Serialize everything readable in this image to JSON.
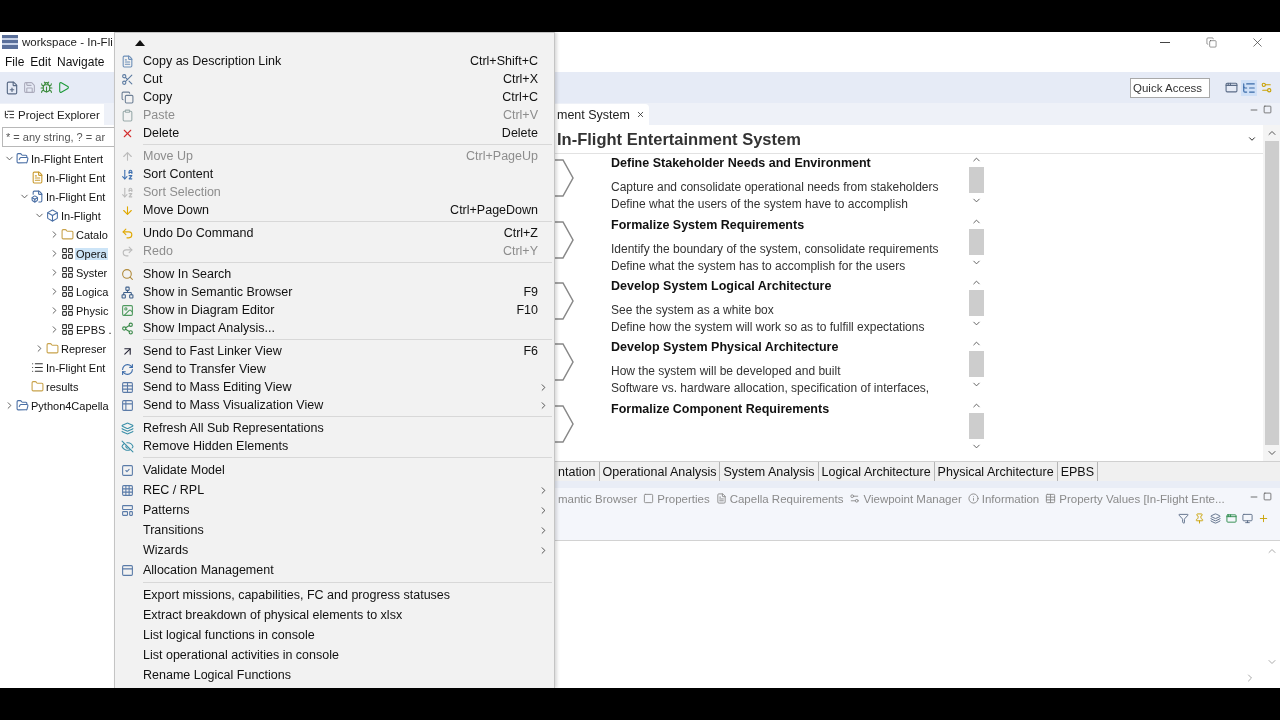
{
  "window": {
    "title": "workspace - In-Fli"
  },
  "menu_bar": [
    "File",
    "Edit",
    "Navigate"
  ],
  "quick_access": {
    "placeholder": "Quick Access"
  },
  "project_explorer": {
    "tab": "Project Explorer",
    "filter": {
      "placeholder": "* = any string, ? = ar"
    },
    "tree": [
      {
        "label": "In-Flight Entert",
        "kind": "project",
        "selected": false,
        "expanded": true,
        "children": [
          {
            "label": "In-Flight Ent",
            "kind": "session",
            "selected": false
          },
          {
            "label": "In-Flight Ent",
            "kind": "model",
            "selected": false,
            "expanded": true,
            "children": [
              {
                "label": "In-Flight",
                "kind": "root",
                "selected": false,
                "expanded": true,
                "children": [
                  {
                    "label": "Catalo",
                    "kind": "folder",
                    "selected": false,
                    "expanded": false
                  },
                  {
                    "label": "Opera",
                    "kind": "layer",
                    "selected": true,
                    "expanded": false
                  },
                  {
                    "label": "Syster",
                    "kind": "layer",
                    "selected": false,
                    "expanded": false
                  },
                  {
                    "label": "Logica",
                    "kind": "layer",
                    "selected": false,
                    "expanded": false
                  },
                  {
                    "label": "Physic",
                    "kind": "layer",
                    "selected": false,
                    "expanded": false
                  },
                  {
                    "label": "EPBS .",
                    "kind": "layer",
                    "selected": false,
                    "expanded": false
                  }
                ]
              },
              {
                "label": "Represer",
                "kind": "folder",
                "selected": false,
                "expanded": false
              }
            ]
          },
          {
            "label": "In-Flight Ent",
            "kind": "list",
            "selected": false
          },
          {
            "label": "results",
            "kind": "folder",
            "selected": false
          }
        ]
      },
      {
        "label": "Python4Capella",
        "kind": "project",
        "selected": false,
        "expanded": false
      }
    ]
  },
  "context_menu": {
    "groups": [
      [
        {
          "label": "Copy as Description Link",
          "shortcut": "Ctrl+Shift+C",
          "disabled": false,
          "submenu": false
        },
        {
          "label": "Cut",
          "shortcut": "Ctrl+X",
          "disabled": false,
          "submenu": false
        },
        {
          "label": "Copy",
          "shortcut": "Ctrl+C",
          "disabled": false,
          "submenu": false
        },
        {
          "label": "Paste",
          "shortcut": "Ctrl+V",
          "disabled": true,
          "submenu": false
        },
        {
          "label": "Delete",
          "shortcut": "Delete",
          "disabled": false,
          "submenu": false
        }
      ],
      [
        {
          "label": "Move Up",
          "shortcut": "Ctrl+PageUp",
          "disabled": true,
          "submenu": false
        },
        {
          "label": "Sort Content",
          "disabled": false,
          "submenu": false
        },
        {
          "label": "Sort Selection",
          "disabled": true,
          "submenu": false
        },
        {
          "label": "Move Down",
          "shortcut": "Ctrl+PageDown",
          "disabled": false,
          "submenu": false
        }
      ],
      [
        {
          "label": "Undo Do Command",
          "shortcut": "Ctrl+Z",
          "disabled": false,
          "submenu": false
        },
        {
          "label": "Redo",
          "shortcut": "Ctrl+Y",
          "disabled": true,
          "submenu": false
        }
      ],
      [
        {
          "label": "Show In Search",
          "disabled": false,
          "submenu": false
        },
        {
          "label": "Show in Semantic Browser",
          "shortcut": "F9",
          "disabled": false,
          "submenu": false
        },
        {
          "label": "Show in Diagram Editor",
          "shortcut": "F10",
          "disabled": false,
          "submenu": false
        },
        {
          "label": "Show Impact Analysis...",
          "disabled": false,
          "submenu": false
        }
      ],
      [
        {
          "label": "Send to Fast Linker View",
          "shortcut": "F6",
          "disabled": false,
          "submenu": false
        },
        {
          "label": "Send to Transfer View",
          "disabled": false,
          "submenu": false
        },
        {
          "label": "Send to Mass Editing View",
          "disabled": false,
          "submenu": true
        },
        {
          "label": "Send to Mass Visualization View",
          "disabled": false,
          "submenu": true
        }
      ],
      [
        {
          "label": "Refresh All Sub Representations",
          "disabled": false,
          "submenu": false
        },
        {
          "label": "Remove Hidden Elements",
          "disabled": false,
          "submenu": false
        }
      ],
      [
        {
          "label": "Validate Model",
          "disabled": false,
          "submenu": false
        },
        {
          "label": "REC / RPL",
          "disabled": false,
          "submenu": true
        },
        {
          "label": "Patterns",
          "disabled": false,
          "submenu": true
        },
        {
          "label": "Transitions",
          "disabled": false,
          "submenu": true
        },
        {
          "label": "Wizards",
          "disabled": false,
          "submenu": true
        },
        {
          "label": "Allocation Management",
          "disabled": false,
          "submenu": false
        }
      ],
      [
        {
          "label": "Export missions, capabilities, FC and progress statuses",
          "disabled": false,
          "submenu": false
        },
        {
          "label": "Extract breakdown of physical elements to xlsx",
          "disabled": false,
          "submenu": false
        },
        {
          "label": "List logical functions in console",
          "disabled": false,
          "submenu": false
        },
        {
          "label": "List operational activities in console",
          "disabled": false,
          "submenu": false
        },
        {
          "label": "Rename Logical Functions",
          "disabled": false,
          "submenu": false
        }
      ]
    ]
  },
  "editor": {
    "tab": "ment System",
    "heading": "In-Flight Entertainment System",
    "sections": [
      {
        "title": "Define Stakeholder Needs and Environment",
        "lines": [
          "Capture and consolidate operational needs from stakeholders",
          "Define what the users of the system have to accomplish"
        ]
      },
      {
        "title": "Formalize System Requirements",
        "lines": [
          "Identify the boundary of the system, consolidate requirements",
          "Define what the system has to accomplish for the users"
        ]
      },
      {
        "title": "Develop System Logical Architecture",
        "lines": [
          "See the system as a white box",
          "Define how the system will work so as to fulfill expectations"
        ]
      },
      {
        "title": "Develop System Physical Architecture",
        "lines": [
          "How the system will be developed and built",
          "Software vs. hardware allocation, specification of interfaces,"
        ]
      },
      {
        "title": "Formalize Component Requirements"
      }
    ],
    "page_tabs": [
      "ntation",
      "Operational Analysis",
      "System Analysis",
      "Logical Architecture",
      "Physical Architecture",
      "EPBS"
    ]
  },
  "views": {
    "tabs": [
      "mantic Browser",
      "Properties",
      "Capella Requirements",
      "Viewpoint Manager",
      "Information",
      "Property Values [In-Flight Ente..."
    ]
  }
}
